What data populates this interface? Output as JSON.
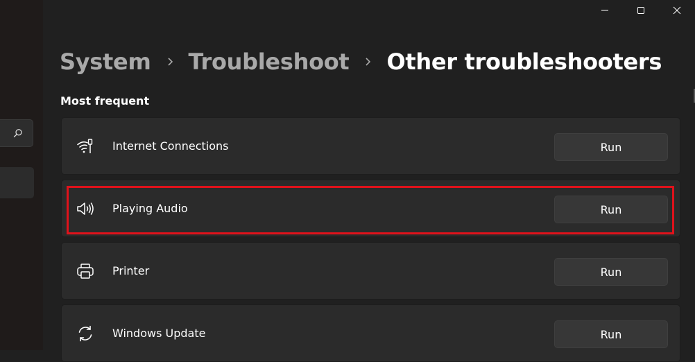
{
  "window": {
    "controls": [
      "minimize",
      "maximize",
      "close"
    ]
  },
  "breadcrumb": {
    "items": [
      "System",
      "Troubleshoot",
      "Other troubleshooters"
    ]
  },
  "section": {
    "title": "Most frequent"
  },
  "troubleshooters": [
    {
      "label": "Internet Connections",
      "icon": "wifi-ethernet-icon",
      "button": "Run"
    },
    {
      "label": "Playing Audio",
      "icon": "speaker-icon",
      "button": "Run",
      "highlighted": true
    },
    {
      "label": "Printer",
      "icon": "printer-icon",
      "button": "Run"
    },
    {
      "label": "Windows Update",
      "icon": "sync-icon",
      "button": "Run"
    }
  ],
  "colors": {
    "background": "#202020",
    "card": "#2b2b2b",
    "button": "#373737",
    "highlight": "#e0121b",
    "breadcrumb_inactive": "#a9a9a9"
  }
}
